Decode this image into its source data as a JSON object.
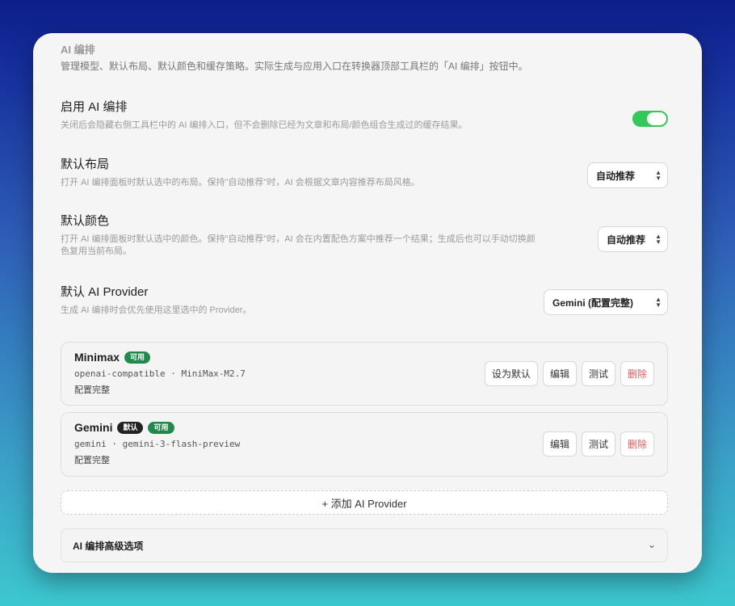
{
  "section": {
    "title": "AI 编排",
    "description": "管理模型、默认布局、默认颜色和缓存策略。实际生成与应用入口在转换器顶部工具栏的「AI 编排」按钮中。"
  },
  "settings": {
    "enable": {
      "label": "启用 AI 编排",
      "description": "关闭后会隐藏右侧工具栏中的 AI 编排入口，但不会删除已经为文章和布局/颜色组合生成过的缓存结果。",
      "enabled": true
    },
    "layout": {
      "label": "默认布局",
      "description": "打开 AI 编排面板时默认选中的布局。保持\"自动推荐\"时，AI 会根据文章内容推荐布局风格。",
      "value": "自动推荐"
    },
    "color": {
      "label": "默认颜色",
      "description_1": "打开 AI 编排面板时默认选中的颜色。保持\"自动推荐\"时，AI 会在内置配色方案中推荐一个结果；生成后也可以手动切换颜",
      "description_2": "色复用当前布局。",
      "value": "自动推荐"
    },
    "provider": {
      "label": "默认 AI Provider",
      "description": "生成 AI 编排时会优先使用这里选中的 Provider。",
      "value": "Gemini (配置完整)"
    }
  },
  "providers": [
    {
      "name": "Minimax",
      "badges": [
        "可用"
      ],
      "meta": "openai-compatible · MiniMax-M2.7",
      "status": "配置完整",
      "actions": [
        "设为默认",
        "编辑",
        "测试",
        "删除"
      ]
    },
    {
      "name": "Gemini",
      "badges": [
        "默认",
        "可用"
      ],
      "meta": "gemini · gemini-3-flash-preview",
      "status": "配置完整",
      "actions": [
        "编辑",
        "测试",
        "删除"
      ]
    }
  ],
  "add_provider_label": "+ 添加 AI Provider",
  "advanced": {
    "label": "AI 编排高级选项",
    "icon": "chevron-down-icon"
  },
  "colors": {
    "toggle_on": "#34c759",
    "badge_available": "#1f8a4c",
    "badge_default": "#222222",
    "danger": "#e05a5a"
  }
}
